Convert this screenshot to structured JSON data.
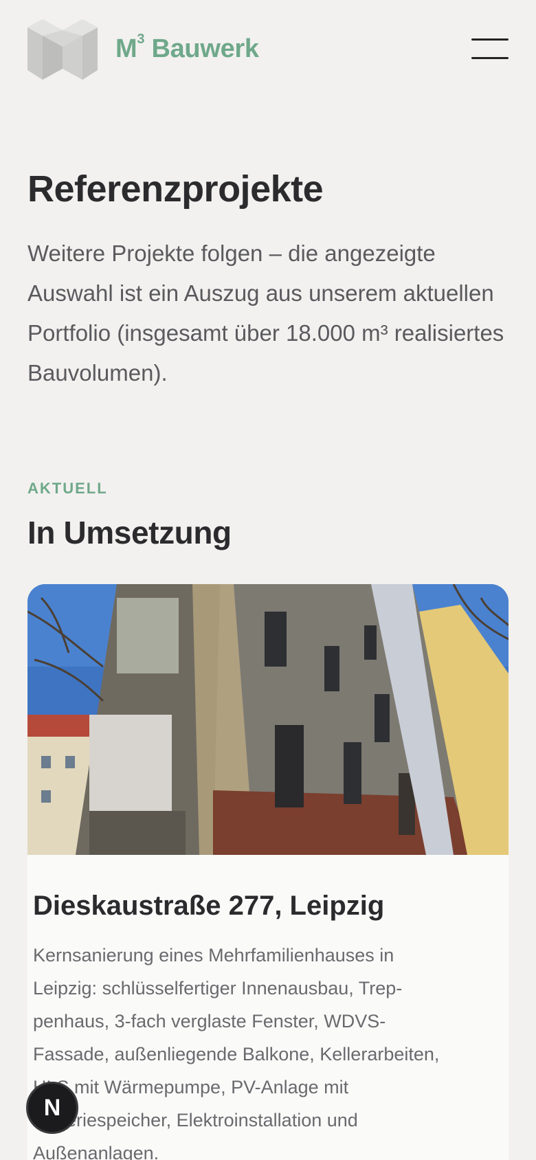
{
  "header": {
    "brand_name": "M",
    "brand_sup": "3",
    "brand_rest": " Bauwerk",
    "menu_icon": "hamburger-icon"
  },
  "intro": {
    "title": "Referenzprojekte",
    "text": "Weitere Projekte folgen – die angezeigte Auswahl ist ein Auszug aus unserem aktu­ellen Portfolio (insgesamt über 18.000 m³ realisiertes Bauvolumen)."
  },
  "section": {
    "eyebrow": "AKTUELL",
    "title": "In Umsetzung"
  },
  "project": {
    "title": "Dieskaustraße 277, Leipzig",
    "description": "Kernsanierung eines Mehrfamilienhauses in Leipzig: schlüsselfertiger Innenausbau, Trep­penhaus, 3-fach verglaste Fenster, WDVS-Fassade, außenliegende Balkone, Kellerar­beiten, HLS mit Wärmepumpe, PV-Anlage mit Batteriespeicher, Elektroinstallation und Außenanlagen."
  },
  "floating_badge": {
    "label": "N"
  },
  "colors": {
    "background": "#f2f1ef",
    "accent_green": "#6fa88a",
    "text_dark": "#2b2b2e",
    "text_muted": "#5a5a5e"
  }
}
